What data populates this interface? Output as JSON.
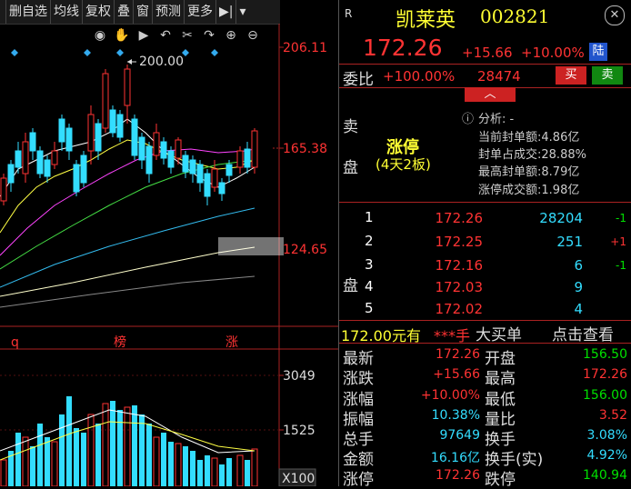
{
  "toolbar": {
    "items": [
      "删自选",
      "均线",
      "复权",
      "叠",
      "窗",
      "预测",
      "更多"
    ],
    "arrow_icon": "play-to-end-icon",
    "dropdown_icon": "chevron-down-icon"
  },
  "chart_tools": [
    "eye-icon",
    "hand-icon",
    "play-circle-icon",
    "undo-icon",
    "scissors-icon",
    "redo-icon",
    "zoom-in-icon",
    "zoom-out-icon"
  ],
  "kline": {
    "price_axis": [
      "206.11",
      "165.38",
      "124.65"
    ],
    "high_marker": "200.00",
    "markers": [
      "q",
      "榜",
      "涨"
    ],
    "volume_axis": [
      "3049",
      "1525",
      "X100"
    ]
  },
  "quote": {
    "badge": "R",
    "name": "凯莱英",
    "code": "002821",
    "price": "172.26",
    "change": "+15.66",
    "change_pct": "+10.00%",
    "exchange": "陆",
    "webi_label": "委比",
    "webi_value": "+100.00%",
    "webi_diff": "28474",
    "buy_btn": "买",
    "sell_btn": "卖",
    "sell_side_label": [
      "卖",
      "盘"
    ],
    "limit_status": "涨停",
    "limit_detail": "(4天2板)",
    "analysis_label": "分析: -",
    "analysis_rows": [
      {
        "label": "当前封单额:",
        "value": "4.86亿"
      },
      {
        "label": "封单占成交:",
        "value": "28.88%"
      },
      {
        "label": "最高封单额:",
        "value": "8.79亿"
      },
      {
        "label": "涨停成交额:",
        "value": "1.98亿"
      }
    ],
    "buy_side_label": "盘",
    "buy_levels": [
      {
        "level": "1",
        "price": "172.26",
        "qty": "28204",
        "delta": "-1"
      },
      {
        "level": "2",
        "price": "172.25",
        "qty": "251",
        "delta": "+1"
      },
      {
        "level": "3",
        "price": "172.16",
        "qty": "6",
        "delta": "-1"
      },
      {
        "level": "4",
        "price": "172.03",
        "qty": "9",
        "delta": ""
      },
      {
        "level": "5",
        "price": "172.02",
        "qty": "4",
        "delta": ""
      }
    ],
    "bigorder": {
      "price": "172.00元有",
      "hand": "***手",
      "label": "大买单",
      "link": "点击查看"
    },
    "stats_left": [
      {
        "label": "最新",
        "value": "172.26",
        "color": "#ff3333"
      },
      {
        "label": "涨跌",
        "value": "+15.66",
        "color": "#ff3333"
      },
      {
        "label": "涨幅",
        "value": "+10.00%",
        "color": "#ff3333"
      },
      {
        "label": "振幅",
        "value": "10.38%",
        "color": "#33ddff"
      },
      {
        "label": "总手",
        "value": "97649",
        "color": "#33ddff"
      },
      {
        "label": "金额",
        "value": "16.16亿",
        "color": "#33ddff"
      },
      {
        "label": "涨停",
        "value": "172.26",
        "color": "#ff3333"
      }
    ],
    "stats_right": [
      {
        "label": "开盘",
        "value": "156.50",
        "color": "#00e000"
      },
      {
        "label": "最高",
        "value": "172.26",
        "color": "#ff3333"
      },
      {
        "label": "最低",
        "value": "156.00",
        "color": "#00e000"
      },
      {
        "label": "量比",
        "value": "3.52",
        "color": "#ff3333"
      },
      {
        "label": "换手",
        "value": "3.08%",
        "color": "#33ddff"
      },
      {
        "label": "换手(实)",
        "value": "4.92%",
        "color": "#33ddff"
      },
      {
        "label": "跌停",
        "value": "140.94",
        "color": "#00e000"
      }
    ]
  },
  "colors": {
    "up": "#ff3333",
    "down": "#33ddff",
    "flat": "#00e000",
    "accent": "#ffff33",
    "bg": "#000000"
  }
}
